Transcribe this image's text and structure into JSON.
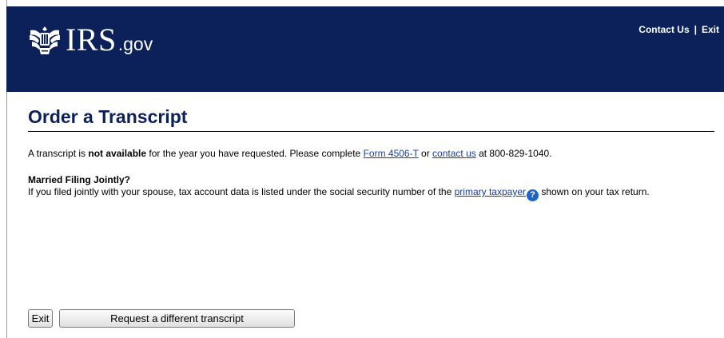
{
  "header": {
    "logo_text": "IRS",
    "logo_suffix": ".gov",
    "links": {
      "contact_us": "Contact Us",
      "separator": "|",
      "exit": "Exit"
    },
    "background_color": "#0c2159"
  },
  "page_title": "Order a Transcript",
  "message": {
    "part1": "A transcript is ",
    "bold": "not available",
    "part2": " for the year you have requested. Please complete ",
    "form_link": "Form 4506-T",
    "part3": " or ",
    "contact_link": "contact us",
    "part4": " at 800-829-1040."
  },
  "married": {
    "heading": "Married Filing Jointly?",
    "text_before": "If you filed jointly with your spouse, tax account data is listed under the social security number of the ",
    "link": "primary taxpayer",
    "help_icon": "?",
    "text_after": " shown on your tax return."
  },
  "buttons": {
    "exit": "Exit",
    "request": "Request a different transcript"
  }
}
